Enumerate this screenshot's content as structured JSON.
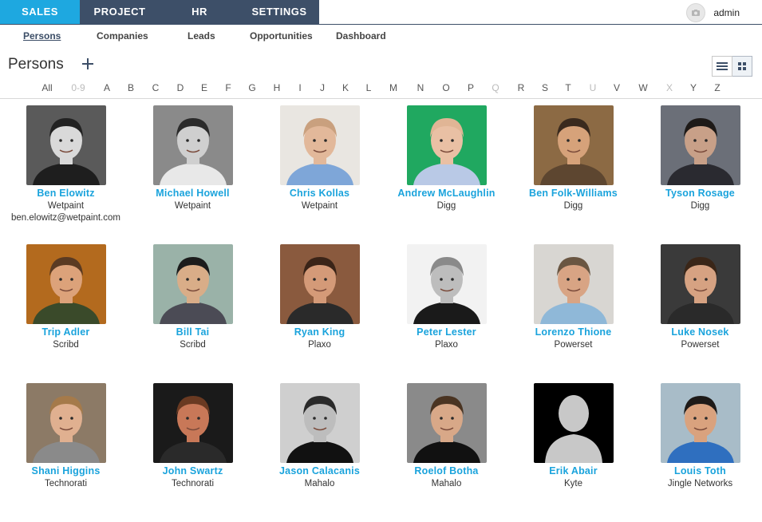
{
  "topnav": {
    "tabs": [
      {
        "label": "SALES",
        "active": true
      },
      {
        "label": "PROJECT",
        "active": false
      },
      {
        "label": "HR",
        "active": false
      },
      {
        "label": "SETTINGS",
        "active": false
      }
    ],
    "user": {
      "name": "admin",
      "avatar_icon": "camera-icon"
    },
    "colors": {
      "bar": "#3d4f68",
      "active": "#1ea8e0"
    }
  },
  "subnav": {
    "items": [
      {
        "label": "Persons",
        "active": true
      },
      {
        "label": "Companies",
        "active": false
      },
      {
        "label": "Leads",
        "active": false
      },
      {
        "label": "Opportunities",
        "active": false
      },
      {
        "label": "Dashboard",
        "active": false
      }
    ]
  },
  "page": {
    "title": "Persons",
    "add_icon": "plus-icon",
    "view_toggle": [
      {
        "icon": "list-view-icon",
        "active": false
      },
      {
        "icon": "grid-view-icon",
        "active": true
      }
    ]
  },
  "alphabet": [
    {
      "label": "All",
      "enabled": true
    },
    {
      "label": "0-9",
      "enabled": false
    },
    {
      "label": "A",
      "enabled": true
    },
    {
      "label": "B",
      "enabled": true
    },
    {
      "label": "C",
      "enabled": true
    },
    {
      "label": "D",
      "enabled": true
    },
    {
      "label": "E",
      "enabled": true
    },
    {
      "label": "F",
      "enabled": true
    },
    {
      "label": "G",
      "enabled": true
    },
    {
      "label": "H",
      "enabled": true
    },
    {
      "label": "I",
      "enabled": true
    },
    {
      "label": "J",
      "enabled": true
    },
    {
      "label": "K",
      "enabled": true
    },
    {
      "label": "L",
      "enabled": true
    },
    {
      "label": "M",
      "enabled": true
    },
    {
      "label": "N",
      "enabled": true
    },
    {
      "label": "O",
      "enabled": true
    },
    {
      "label": "P",
      "enabled": true
    },
    {
      "label": "Q",
      "enabled": false
    },
    {
      "label": "R",
      "enabled": true
    },
    {
      "label": "S",
      "enabled": true
    },
    {
      "label": "T",
      "enabled": true
    },
    {
      "label": "U",
      "enabled": false
    },
    {
      "label": "V",
      "enabled": true
    },
    {
      "label": "W",
      "enabled": true
    },
    {
      "label": "X",
      "enabled": false
    },
    {
      "label": "Y",
      "enabled": true
    },
    {
      "label": "Z",
      "enabled": true
    }
  ],
  "persons": [
    {
      "name": "Ben Elowitz",
      "company": "Wetpaint",
      "email": "ben.elowitz@wetpaint.com",
      "bg": "#5a5a5a",
      "skin": "#d9d9d9",
      "hair": "#222222",
      "shirt": "#1e1e1e"
    },
    {
      "name": "Michael Howell",
      "company": "Wetpaint",
      "email": "",
      "bg": "#8a8a8a",
      "skin": "#cfcfcf",
      "hair": "#2b2b2b",
      "shirt": "#e8e8e8"
    },
    {
      "name": "Chris Kollas",
      "company": "Wetpaint",
      "email": "",
      "bg": "#e9e6e1",
      "skin": "#e2b89a",
      "hair": "#c9a07e",
      "shirt": "#7ea6d8"
    },
    {
      "name": "Andrew McLaughlin",
      "company": "Digg",
      "email": "",
      "bg": "#20a860",
      "skin": "#e9c0a4",
      "hair": "#e0b595",
      "shirt": "#b9c9e6"
    },
    {
      "name": "Ben Folk-Williams",
      "company": "Digg",
      "email": "",
      "bg": "#8c6a44",
      "skin": "#d6a27a",
      "hair": "#3a2a1e",
      "shirt": "#5d4630"
    },
    {
      "name": "Tyson Rosage",
      "company": "Digg",
      "email": "",
      "bg": "#6b6f78",
      "skin": "#c8a088",
      "hair": "#1e1a18",
      "shirt": "#2a2a30"
    },
    {
      "name": "Trip Adler",
      "company": "Scribd",
      "email": "",
      "bg": "#b36a1e",
      "skin": "#dca27a",
      "hair": "#5a3a22",
      "shirt": "#3a4a2a"
    },
    {
      "name": "Bill Tai",
      "company": "Scribd",
      "email": "",
      "bg": "#9ab2a8",
      "skin": "#d9ad88",
      "hair": "#1c1c1c",
      "shirt": "#4b4b55"
    },
    {
      "name": "Ryan King",
      "company": "Plaxo",
      "email": "",
      "bg": "#8a5a3e",
      "skin": "#d49a78",
      "hair": "#3a2418",
      "shirt": "#2a2a2a"
    },
    {
      "name": "Peter Lester",
      "company": "Plaxo",
      "email": "",
      "bg": "#f2f2f2",
      "skin": "#bdbdbd",
      "hair": "#8a8a8a",
      "shirt": "#1a1a1a"
    },
    {
      "name": "Lorenzo Thione",
      "company": "Powerset",
      "email": "",
      "bg": "#d8d6d2",
      "skin": "#d8a484",
      "hair": "#6a5642",
      "shirt": "#8fb8d8"
    },
    {
      "name": "Luke Nosek",
      "company": "Powerset",
      "email": "",
      "bg": "#3a3a3a",
      "skin": "#d6a282",
      "hair": "#3a2618",
      "shirt": "#2a2a2a"
    },
    {
      "name": "Shani Higgins",
      "company": "Technorati",
      "email": "",
      "bg": "#8c7a66",
      "skin": "#e0b090",
      "hair": "#a57a4a",
      "shirt": "#8a8a8a"
    },
    {
      "name": "John Swartz",
      "company": "Technorati",
      "email": "",
      "bg": "#1a1a1a",
      "skin": "#c87858",
      "hair": "#6a3a22",
      "shirt": "#2a2a2a"
    },
    {
      "name": "Jason Calacanis",
      "company": "Mahalo",
      "email": "",
      "bg": "#cfcfcf",
      "skin": "#bdbdbd",
      "hair": "#2a2a2a",
      "shirt": "#111111"
    },
    {
      "name": "Roelof Botha",
      "company": "Mahalo",
      "email": "",
      "bg": "#8a8a8a",
      "skin": "#d8a888",
      "hair": "#4a3422",
      "shirt": "#111111"
    },
    {
      "name": "Erik Abair",
      "company": "Kyte",
      "email": "",
      "bg": "#000000",
      "skin": "#c8c8c8",
      "hair": "#c8c8c8",
      "shirt": "#c8c8c8",
      "placeholder": true
    },
    {
      "name": "Louis Toth",
      "company": "Jingle Networks",
      "email": "",
      "bg": "#a8bcc8",
      "skin": "#d9a27e",
      "hair": "#1e1a18",
      "shirt": "#2f6fbf"
    }
  ]
}
